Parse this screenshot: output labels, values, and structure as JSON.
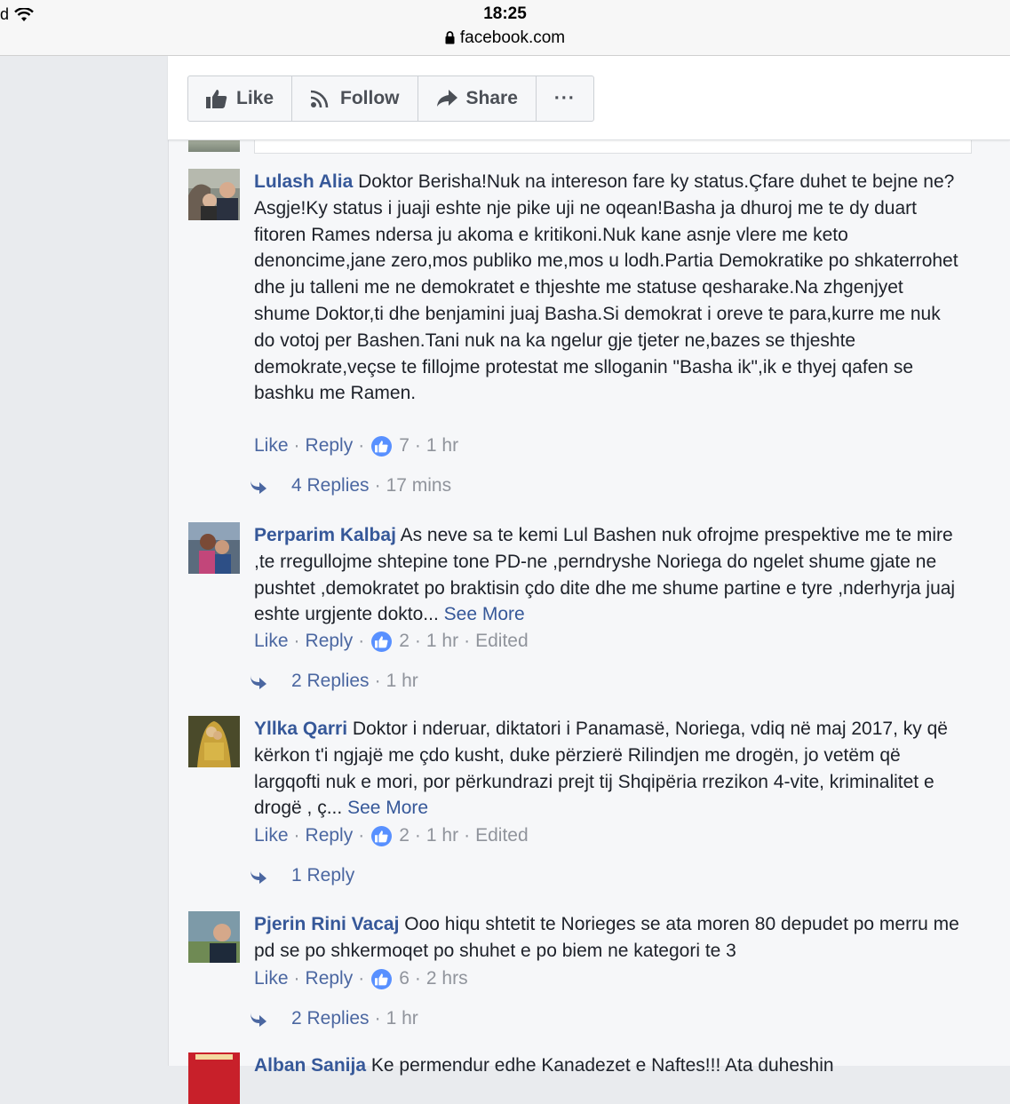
{
  "status_bar": {
    "time": "18:25",
    "url": "facebook.com",
    "carrier_fragment": "d"
  },
  "action_bar": {
    "like_label": "Like",
    "follow_label": "Follow",
    "share_label": "Share",
    "more_label": "···"
  },
  "comments": [
    {
      "author": "Lulash Alia",
      "text": "Doktor Berisha!Nuk na intereson fare ky status.Çfare duhet te bejne ne?Asgje!Ky status i juaji eshte nje pike uji ne oqean!Basha ja dhuroj me te dy duart fitoren Rames ndersa ju akoma e kritikoni.Nuk kane asnje vlere me keto denoncime,jane zero,mos publiko me,mos u lodh.Partia Demokratike po shkaterrohet dhe ju talleni me ne demokratet e thjeshte me statuse qesharake.Na zhgenjyet shume Doktor,ti dhe benjamini juaj Basha.Si demokrat i oreve te para,kurre me nuk do votoj per Bashen.Tani nuk na ka ngelur gje tjeter ne,bazes se thjeshte demokrate,veçse te fillojme protestat me slloganin \"Basha ik\",ik e thyej qafen se bashku me Ramen.",
      "see_more": "",
      "like": "Like",
      "reply": "Reply",
      "likes": "7",
      "time": "1 hr",
      "edited": "",
      "replies_label": "4 Replies",
      "replies_time": "17 mins"
    },
    {
      "author": "Perparim Kalbaj",
      "text": "As neve sa te kemi Lul Bashen nuk ofrojme prespektive me te mire ,te rregullojme shtepine tone PD-ne ,perndryshe Noriega do ngelet shume gjate ne pushtet ,demokratet po braktisin çdo dite dhe me shume partine e tyre ,nderhyrja juaj eshte urgjente dokto...",
      "see_more": "See More",
      "like": "Like",
      "reply": "Reply",
      "likes": "2",
      "time": "1 hr",
      "edited": "Edited",
      "replies_label": "2 Replies",
      "replies_time": "1 hr"
    },
    {
      "author": "Yllka Qarri",
      "text": "Doktor i nderuar, diktatori i Panamasë, Noriega, vdiq në maj 2017, ky që kërkon t'i ngjajë me çdo kusht, duke përzierë Rilindjen me drogën, jo vetëm që largqofti nuk e mori, por përkundrazi prejt tij Shqipëria rrezikon 4-vite, kriminalitet e drogë , ç...",
      "see_more": "See More",
      "like": "Like",
      "reply": "Reply",
      "likes": "2",
      "time": "1 hr",
      "edited": "Edited",
      "replies_label": "1 Reply",
      "replies_time": ""
    },
    {
      "author": "Pjerin Rini Vacaj",
      "text": "Ooo hiqu shtetit te Norieges se ata moren 80 depudet po merru me pd se po shkermoqet po shuhet e po biem ne kategori te 3",
      "see_more": "",
      "like": "Like",
      "reply": "Reply",
      "likes": "6",
      "time": "2 hrs",
      "edited": "",
      "replies_label": "2 Replies",
      "replies_time": "1 hr"
    },
    {
      "author": "Alban Sanija",
      "text": "Ke permendur edhe Kanadezet e Naftes!!! Ata duheshin",
      "see_more": ""
    }
  ]
}
